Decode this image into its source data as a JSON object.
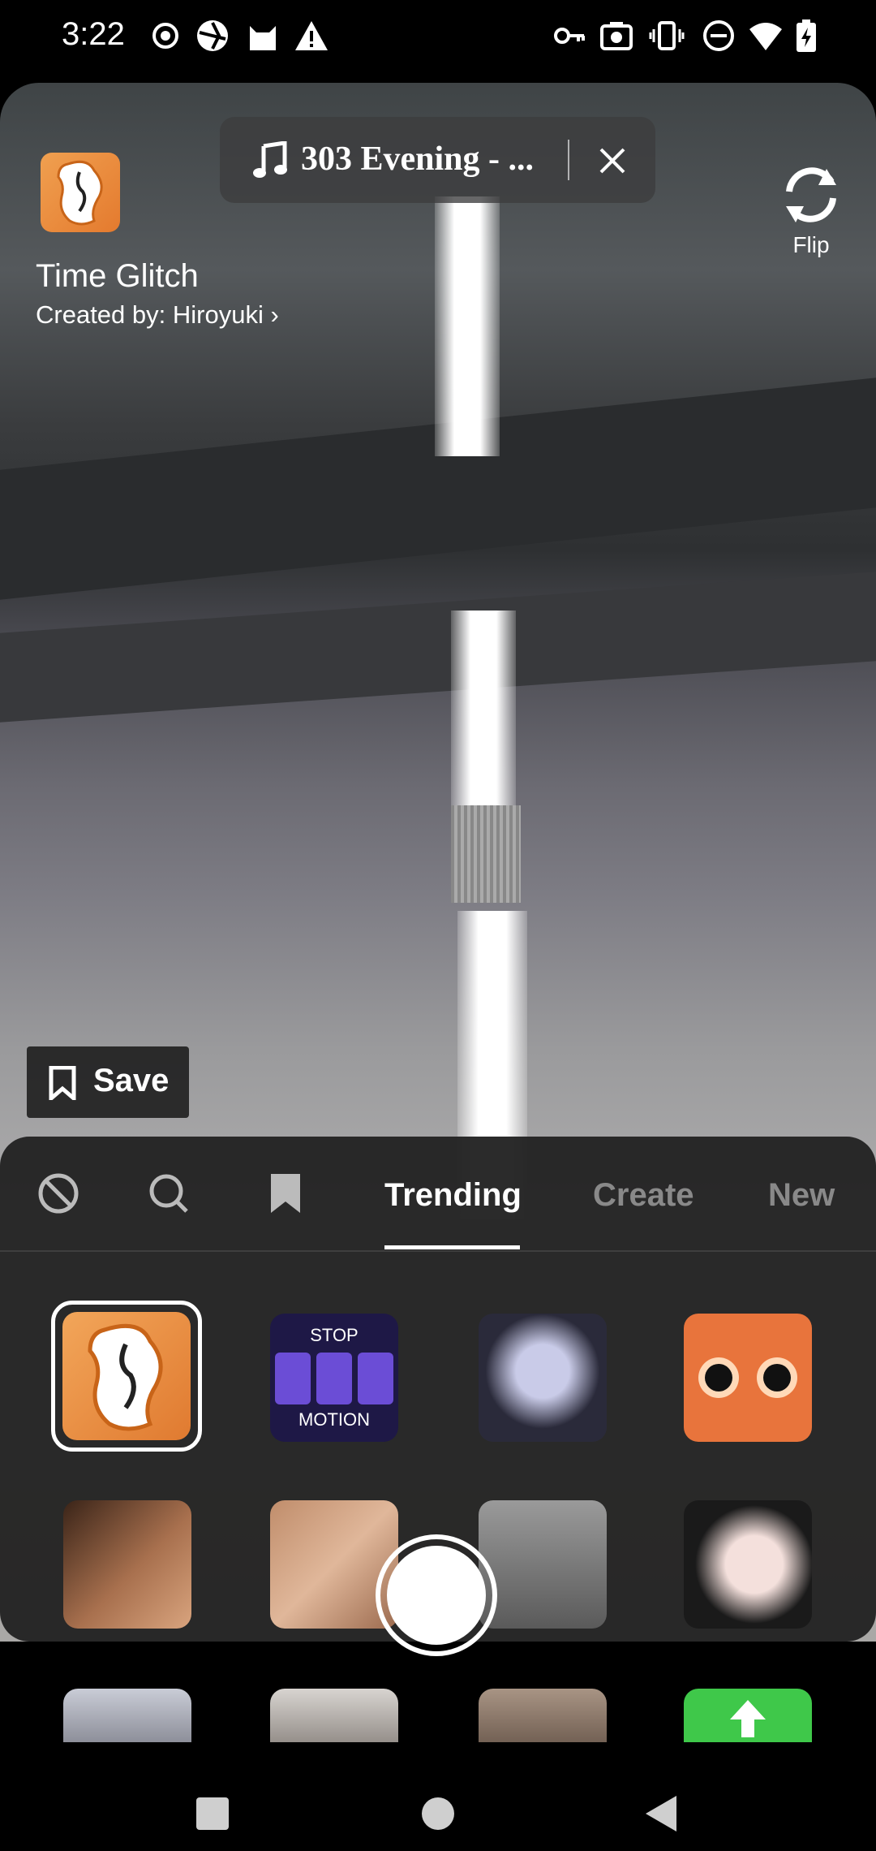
{
  "status_bar": {
    "time": "3:22",
    "left_icons": [
      "record-icon",
      "camera-shutter-icon",
      "cat-icon",
      "warning-icon"
    ],
    "right_icons": [
      "key-icon",
      "screenshot-icon",
      "vibrate-icon",
      "do-not-disturb-icon",
      "wifi-icon",
      "battery-charging-icon"
    ]
  },
  "effect": {
    "title": "Time Glitch",
    "creator": "Created by: Hiroyuki",
    "icon": "melting-clock-icon",
    "accent": "#e8893a"
  },
  "music": {
    "icon": "music-note-icon",
    "title": "303 Evening - ...",
    "close_icon": "close-icon"
  },
  "flip": {
    "label": "Flip",
    "icon": "flip-camera-icon"
  },
  "save": {
    "label": "Save",
    "icon": "bookmark-icon"
  },
  "effects_panel": {
    "icon_tabs": [
      "no-effect-icon",
      "search-icon",
      "bookmark-icon"
    ],
    "tabs": [
      {
        "label": "Trending",
        "active": true
      },
      {
        "label": "Create",
        "active": false
      },
      {
        "label": "New",
        "active": false
      }
    ],
    "row1": [
      {
        "name": "time-glitch-effect",
        "selected": true
      },
      {
        "name": "stop-motion-effect",
        "top_text": "STOP",
        "bottom_text": "MOTION"
      },
      {
        "name": "anime-face-effect"
      },
      {
        "name": "cartoon-eyes-effect"
      }
    ],
    "row2": [
      {
        "name": "glow-skin-effect"
      },
      {
        "name": "freckles-effect"
      },
      {
        "name": "bw-portrait-effect"
      },
      {
        "name": "doll-face-effect"
      }
    ]
  },
  "shutter": {
    "icon": "capture-button"
  },
  "nav": [
    "recents-icon",
    "home-icon",
    "back-icon"
  ]
}
